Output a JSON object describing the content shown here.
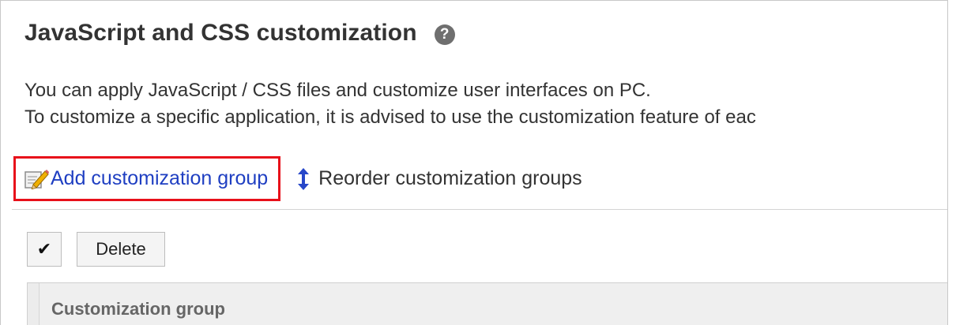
{
  "header": {
    "title": "JavaScript and CSS customization",
    "help_icon": "question-mark-circle"
  },
  "description": {
    "line1": "You can apply JavaScript / CSS files and customize user interfaces on PC.",
    "line2": "To customize a specific application, it is advised to use the customization feature of eac"
  },
  "actions": {
    "add_group_label": "Add customization group",
    "add_group_icon": "edit-pencil-icon",
    "reorder_label": "Reorder customization groups",
    "reorder_icon": "vertical-arrows-icon",
    "highlight_color": "#e8101a",
    "link_color": "#1f3fc2"
  },
  "toolbar": {
    "check_all_label": "✔",
    "delete_label": "Delete"
  },
  "table": {
    "columns": [
      "Customization group"
    ]
  }
}
